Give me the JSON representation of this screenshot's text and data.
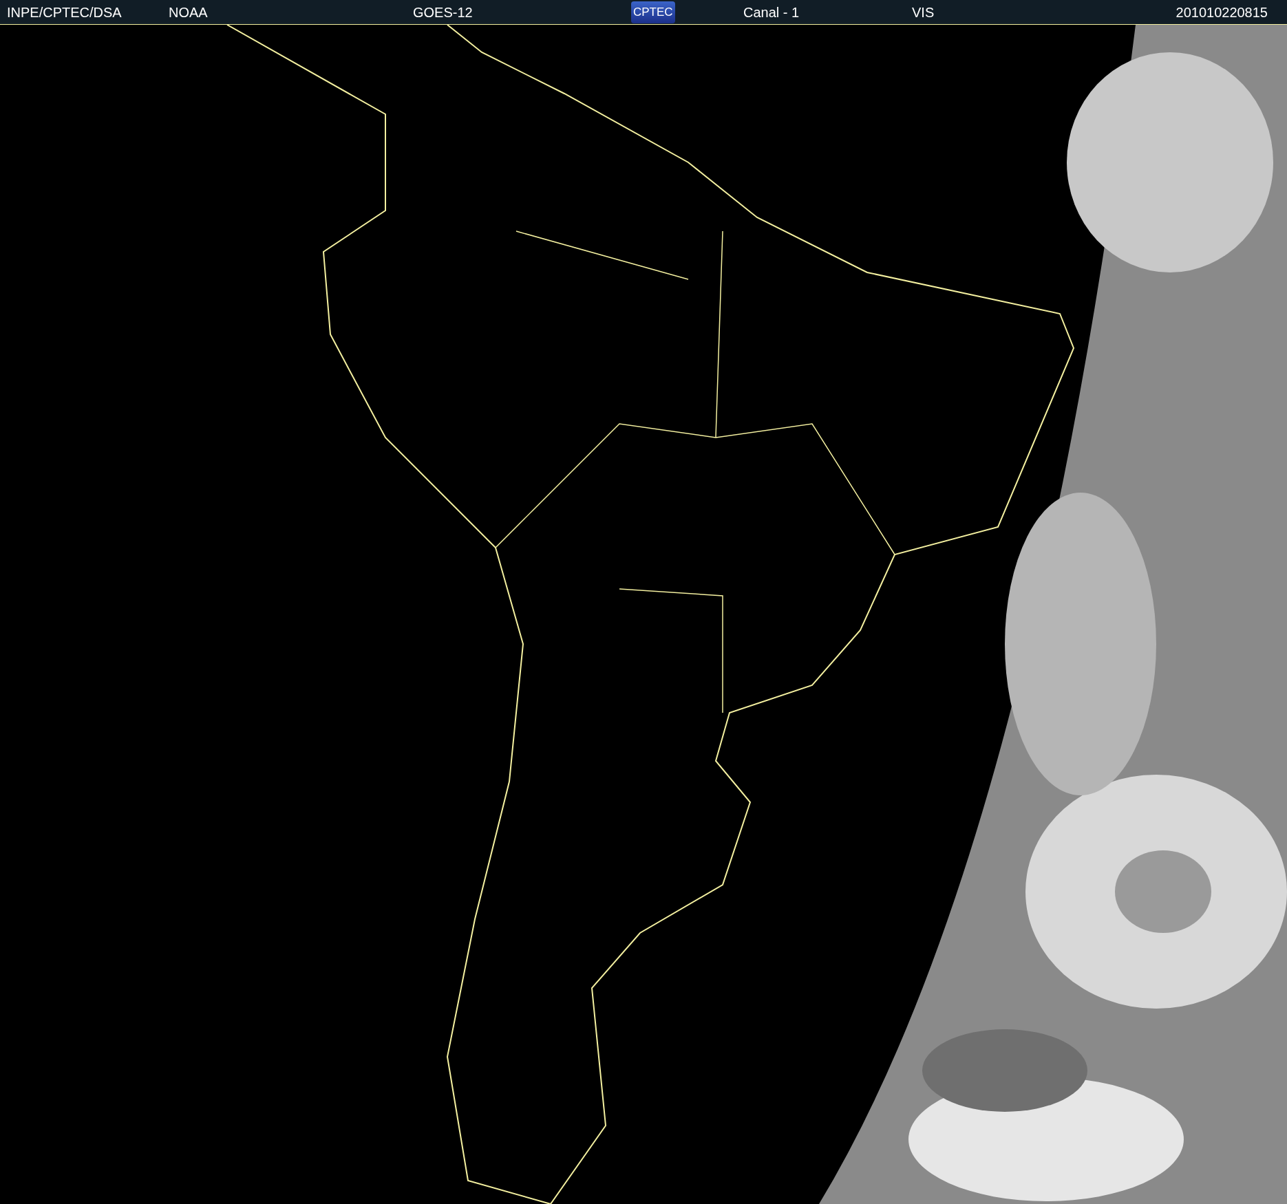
{
  "header": {
    "items": [
      {
        "kind": "text",
        "text": "INPE/CPTEC/DSA"
      },
      {
        "kind": "text",
        "text": "NOAA"
      },
      {
        "kind": "text",
        "text": "GOES-12"
      },
      {
        "kind": "logo",
        "text": "CPTEC"
      },
      {
        "kind": "text",
        "text": "Canal - 1"
      },
      {
        "kind": "text",
        "text": "VIS"
      },
      {
        "kind": "text",
        "text": "201010220815"
      }
    ]
  }
}
